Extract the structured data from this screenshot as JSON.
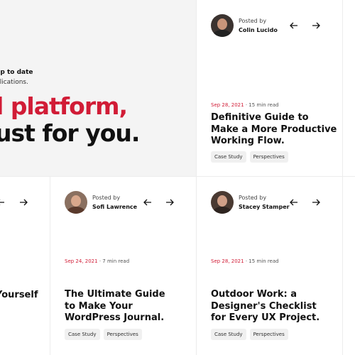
{
  "hero": {
    "subline_1": "up to date",
    "subline_2": "blications.",
    "headline_prefix": "l ",
    "headline_accent": "platform,",
    "headline_line_2": "ust for you."
  },
  "cards": [
    {
      "posted_by": "Posted by",
      "author": "Colin Lucido",
      "date": "Sep 28, 2021",
      "read_time": " · 15 min read",
      "title": "Definitive Guide to Make a More Productive Working Flow.",
      "tags": [
        "Case Study",
        "Perspectives"
      ]
    },
    {
      "posted_by": "Posted by",
      "author": "Sofi Lawrence",
      "date": "Sep 24, 2021",
      "read_time": " · 7 min read",
      "title": "The Ultimate Guide to Make Your WordPress Journal.",
      "tags": [
        "Case Study",
        "Perspectives"
      ]
    },
    {
      "posted_by": "Posted by",
      "author": "Stacey Stamper",
      "date": "Sep 28, 2021",
      "read_time": " · 15 min read",
      "title": "Outdoor Work: a Designer's Checklist for Every UX Project.",
      "tags": [
        "Case Study",
        "Perspectives"
      ]
    }
  ],
  "partial_card": {
    "title_fragment": "Yourself"
  },
  "colors": {
    "accent": "#d11c36",
    "hero_bg": "#f4f4f4"
  },
  "icons": {
    "prev": "arrow-left-icon",
    "next": "arrow-right-icon"
  }
}
